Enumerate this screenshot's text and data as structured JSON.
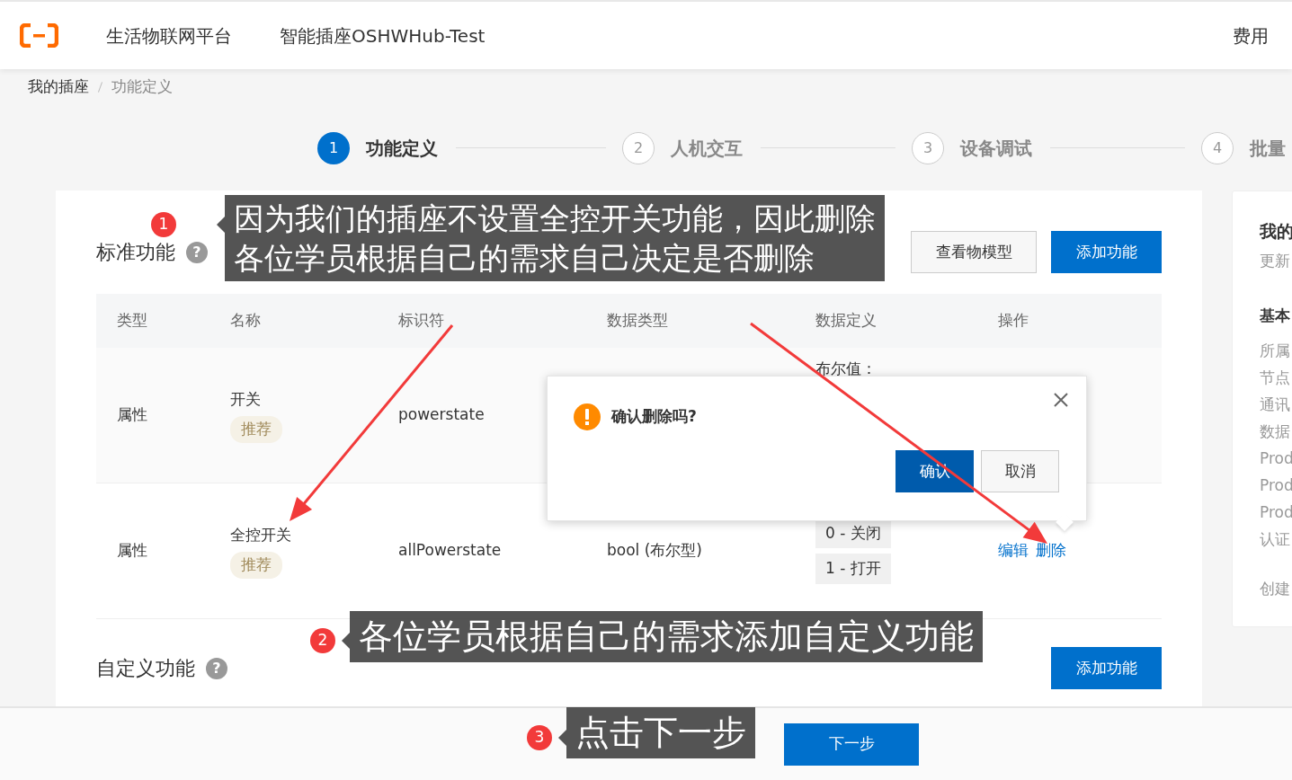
{
  "header": {
    "platform": "生活物联网平台",
    "product": "智能插座OSHWHub-Test",
    "right_link": "费用"
  },
  "breadcrumb": [
    {
      "label": "我的插座",
      "current": false
    },
    {
      "label": "功能定义",
      "current": true
    }
  ],
  "steps": [
    {
      "number": "1",
      "label": "功能定义",
      "selected": true
    },
    {
      "number": "2",
      "label": "人机交互",
      "selected": false
    },
    {
      "number": "3",
      "label": "设备调试",
      "selected": false
    },
    {
      "number": "4",
      "label": "批量",
      "selected": false
    }
  ],
  "standard_section": {
    "title": "标准功能",
    "help": "?",
    "buttons": [
      {
        "label": "查看物模型",
        "kind": "secondary"
      },
      {
        "label": "添加功能",
        "kind": "primary"
      }
    ],
    "table": {
      "columns": [
        "类型",
        "名称",
        "标识符",
        "数据类型",
        "数据定义",
        "操作"
      ],
      "rows": [
        {
          "type": "属性",
          "name": "开关",
          "tag": "推荐",
          "identifier": "powerstate",
          "definition_label": "布尔值："
        },
        {
          "type": "属性",
          "name": "全控开关",
          "tag": "推荐",
          "identifier": "allPowerstate",
          "data_type": "bool (布尔型)",
          "definition_values": [
            "0 - 关闭",
            "1 - 打开"
          ],
          "actions": [
            "编辑",
            "删除"
          ]
        }
      ]
    }
  },
  "custom_section": {
    "title": "自定义功能",
    "help": "?",
    "buttons": [
      {
        "label": "添加功能",
        "kind": "primary"
      }
    ]
  },
  "dialog": {
    "message": "确认删除吗?",
    "buttons": [
      {
        "label": "确认",
        "kind": "primary"
      },
      {
        "label": "取消",
        "kind": "secondary"
      }
    ]
  },
  "side_panel": {
    "title": "我的",
    "subtitle": "更新",
    "section": "基本",
    "items": [
      "所属",
      "节点",
      "通讯",
      "数据",
      "Prod",
      "Prod",
      "Prod",
      "认证"
    ],
    "footer": "创建"
  },
  "footer": {
    "next_button": "下一步"
  },
  "annotations": [
    {
      "number": "1",
      "lines": [
        "因为我们的插座不设置全控开关功能，因此删除",
        "各位学员根据自己的需求自己决定是否删除"
      ]
    },
    {
      "number": "2",
      "lines": [
        "各位学员根据自己的需求添加自定义功能"
      ]
    },
    {
      "number": "3",
      "lines": [
        "点击下一步"
      ]
    }
  ]
}
